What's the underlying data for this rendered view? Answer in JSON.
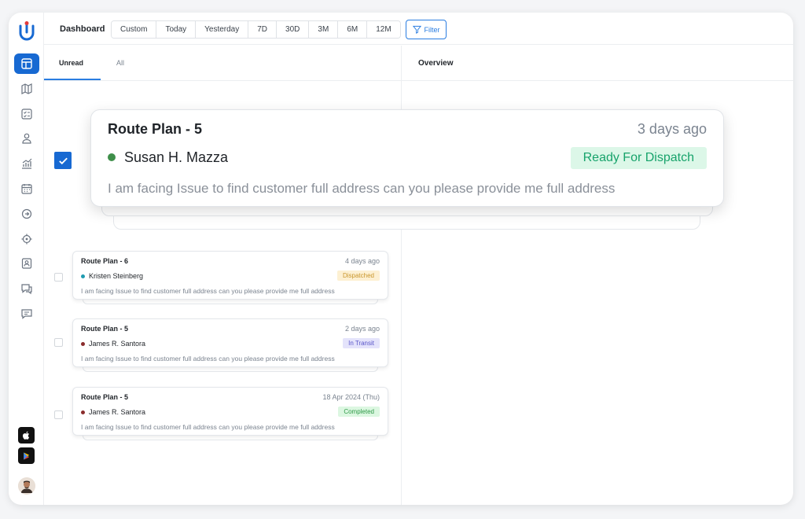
{
  "header": {
    "title": "Dashboard",
    "ranges": [
      "Custom",
      "Today",
      "Yesterday",
      "7D",
      "30D",
      "3M",
      "6M",
      "12M"
    ],
    "filter_label": "Filter"
  },
  "tabs": {
    "unread": "Unread",
    "all": "All"
  },
  "overview": {
    "title": "Overview"
  },
  "sidebar": {
    "items": [
      "dashboard-icon",
      "map-icon",
      "checklist-icon",
      "users-icon",
      "analytics-icon",
      "calendar-icon",
      "dispatch-icon",
      "location-icon",
      "contacts-icon",
      "support-icon",
      "messages-icon"
    ]
  },
  "hero": {
    "title": "Route Plan - 5",
    "time": "3 days ago",
    "name": "Susan H. Mazza",
    "status": "Ready For Dispatch",
    "message": "I am facing Issue to find customer full address can you please provide me full address",
    "dot_color": "#3f8f4a",
    "status_color": "#17a36b"
  },
  "messages": [
    {
      "title": "Route Plan - 6",
      "time": "4 days ago",
      "name": "Kristen Steinberg",
      "status": "Dispatched",
      "message": "I am facing Issue to find customer full address can you please provide me full address",
      "dot_color": "#1f9bb0",
      "badge_bg": "#fdf0d2",
      "badge_fg": "#c9962c"
    },
    {
      "title": "Route Plan - 5",
      "time": "2 days ago",
      "name": "James R. Santora",
      "status": "In Transit",
      "message": "I am facing Issue to find customer full address can you please provide me full address",
      "dot_color": "#8a2c2c",
      "badge_bg": "#e4e3fb",
      "badge_fg": "#5a55c9"
    },
    {
      "title": "Route Plan - 5",
      "time": "18 Apr 2024 (Thu)",
      "name": "James R. Santora",
      "status": "Completed",
      "message": "I am facing Issue to find customer full address can you please provide me full address",
      "dot_color": "#8a2c2c",
      "badge_bg": "#dcf7e1",
      "badge_fg": "#2f9a48"
    }
  ]
}
